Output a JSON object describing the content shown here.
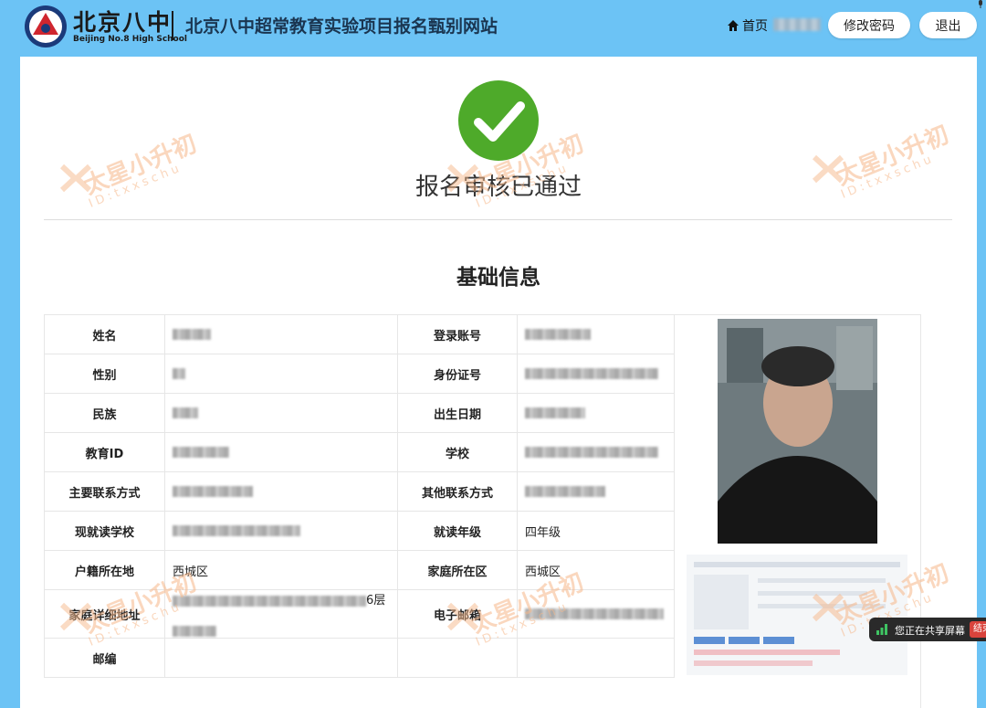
{
  "header": {
    "logo_cn": "北京八中",
    "logo_en": "Beijing No.8 High School",
    "site_title": "北京八中超常教育实验项目报名甄别网站",
    "home_label": "首页",
    "change_password": "修改密码",
    "logout": "退出"
  },
  "status": {
    "text": "报名审核已通过"
  },
  "section": {
    "title": "基础信息"
  },
  "info": {
    "name_label": "姓名",
    "account_label": "登录账号",
    "gender_label": "性别",
    "id_card_label": "身份证号",
    "ethnicity_label": "民族",
    "birth_label": "出生日期",
    "edu_id_label": "教育ID",
    "school_label": "学校",
    "main_contact_label": "主要联系方式",
    "other_contact_label": "其他联系方式",
    "current_school_label": "现就读学校",
    "grade_label": "就读年级",
    "grade_value": "四年级",
    "hukou_label": "户籍所在地",
    "hukou_value": "西城区",
    "home_district_label": "家庭所在区",
    "home_district_value": "西城区",
    "address_label": "家庭详细地址",
    "address_tail": "6层",
    "email_label": "电子邮箱",
    "postcode_label": "邮编"
  },
  "watermark": {
    "cn": "太星小升初",
    "en": "ID:txxschu"
  },
  "share": {
    "text": "您正在共享屏幕",
    "end": "结束"
  },
  "colors": {
    "header_bg": "#6cc3f5",
    "success_green": "#4eaa2a",
    "watermark": "#f7b88a"
  }
}
